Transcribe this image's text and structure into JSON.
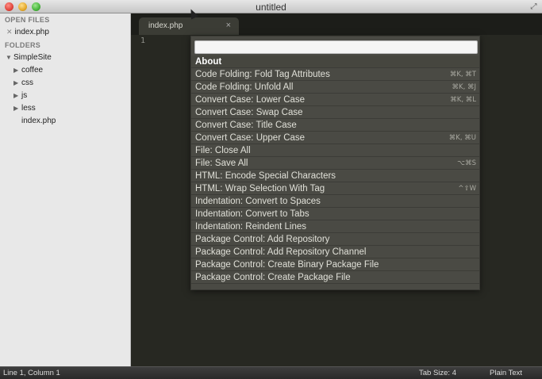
{
  "window": {
    "title": "untitled"
  },
  "sidebar": {
    "open_files_title": "OPEN FILES",
    "open_files": [
      {
        "name": "index.php"
      }
    ],
    "folders_title": "FOLDERS",
    "root": {
      "name": "SimpleSite"
    },
    "items": [
      {
        "name": "coffee",
        "type": "folder"
      },
      {
        "name": "css",
        "type": "folder"
      },
      {
        "name": "js",
        "type": "folder"
      },
      {
        "name": "less",
        "type": "folder"
      },
      {
        "name": "index.php",
        "type": "file"
      }
    ]
  },
  "editor": {
    "tab_label": "index.php",
    "line_number": "1"
  },
  "palette": {
    "input_value": "",
    "items": [
      {
        "label": "About",
        "shortcut": ""
      },
      {
        "label": "Code Folding: Fold Tag Attributes",
        "shortcut": "⌘K, ⌘T"
      },
      {
        "label": "Code Folding: Unfold All",
        "shortcut": "⌘K, ⌘J"
      },
      {
        "label": "Convert Case: Lower Case",
        "shortcut": "⌘K, ⌘L"
      },
      {
        "label": "Convert Case: Swap Case",
        "shortcut": ""
      },
      {
        "label": "Convert Case: Title Case",
        "shortcut": ""
      },
      {
        "label": "Convert Case: Upper Case",
        "shortcut": "⌘K, ⌘U"
      },
      {
        "label": "File: Close All",
        "shortcut": ""
      },
      {
        "label": "File: Save All",
        "shortcut": "⌥⌘S"
      },
      {
        "label": "HTML: Encode Special Characters",
        "shortcut": ""
      },
      {
        "label": "HTML: Wrap Selection With Tag",
        "shortcut": "^⇧W"
      },
      {
        "label": "Indentation: Convert to Spaces",
        "shortcut": ""
      },
      {
        "label": "Indentation: Convert to Tabs",
        "shortcut": ""
      },
      {
        "label": "Indentation: Reindent Lines",
        "shortcut": ""
      },
      {
        "label": "Package Control: Add Repository",
        "shortcut": ""
      },
      {
        "label": "Package Control: Add Repository Channel",
        "shortcut": ""
      },
      {
        "label": "Package Control: Create Binary Package File",
        "shortcut": ""
      },
      {
        "label": "Package Control: Create Package File",
        "shortcut": ""
      }
    ]
  },
  "statusbar": {
    "position": "Line 1, Column 1",
    "tab_size": "Tab Size: 4",
    "syntax": "Plain Text"
  },
  "colors": {
    "editor_bg": "#272822",
    "sidebar_bg": "#e8e8e8",
    "palette_bg": "#4a4a44"
  }
}
